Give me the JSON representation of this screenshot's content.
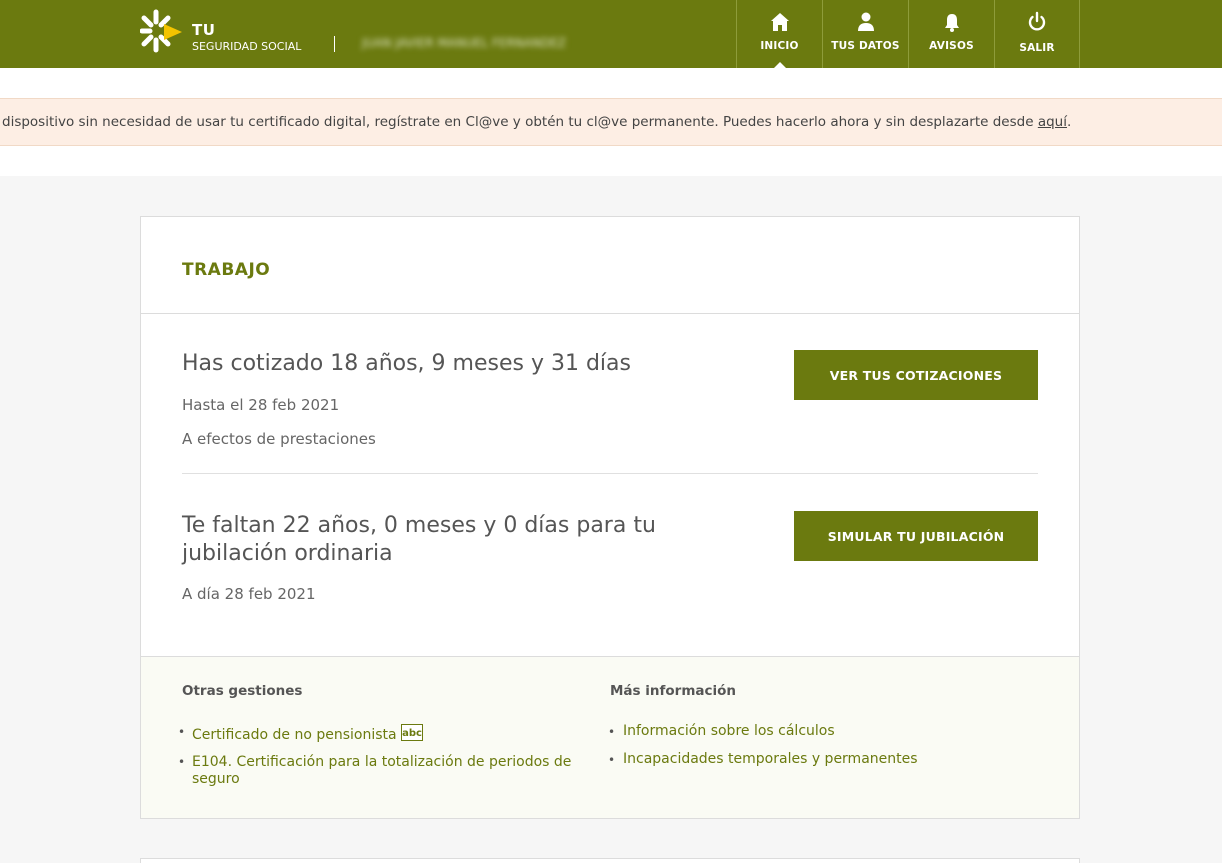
{
  "header": {
    "brand_line1": "TU",
    "brand_line2": "SEGURIDAD SOCIAL",
    "user_name": "JUAN JAVIER MANUEL FERNANDEZ",
    "nav": [
      {
        "label": "INICIO",
        "icon": "home-icon",
        "active": true
      },
      {
        "label": "TUS DATOS",
        "icon": "user-icon",
        "active": false
      },
      {
        "label": "AVISOS",
        "icon": "bell-icon",
        "active": false
      },
      {
        "label": "SALIR",
        "icon": "power-icon",
        "active": false
      }
    ]
  },
  "banner": {
    "text": "dispositivo sin necesidad de usar tu certificado digital, regístrate en Cl@ve y obtén tu cl@ve permanente. Puedes hacerlo ahora y sin desplazarte desde ",
    "link": "aquí",
    "suffix": "."
  },
  "card": {
    "title": "TRABAJO",
    "section1": {
      "headline": "Has cotizado 18 años, 9 meses y 31 días",
      "line1": "Hasta el 28 feb 2021",
      "line2": "A efectos de prestaciones",
      "button": "VER TUS COTIZACIONES"
    },
    "section2": {
      "headline_line1": "Te faltan 22 años, 0 meses y 0 días para tu",
      "headline_line2": "jubilación ordinaria",
      "line1": "A día 28 feb 2021",
      "button": "SIMULAR TU JUBILACIÓN"
    },
    "otras": {
      "title": "Otras gestiones",
      "items": [
        {
          "line1": "Certificado de no pensionista",
          "line2": ""
        },
        {
          "line1": "E104. Certificación para la totalización de periodos de",
          "line2": "seguro"
        }
      ],
      "abc_label": "abc"
    },
    "mas": {
      "title": "Más información",
      "items": [
        "Información sobre los cálculos",
        "Incapacidades temporales y permanentes"
      ]
    }
  },
  "colors": {
    "brand": "#6b7a0f",
    "banner_bg": "#fdeee4",
    "logo_yellow": "#f4c400"
  }
}
